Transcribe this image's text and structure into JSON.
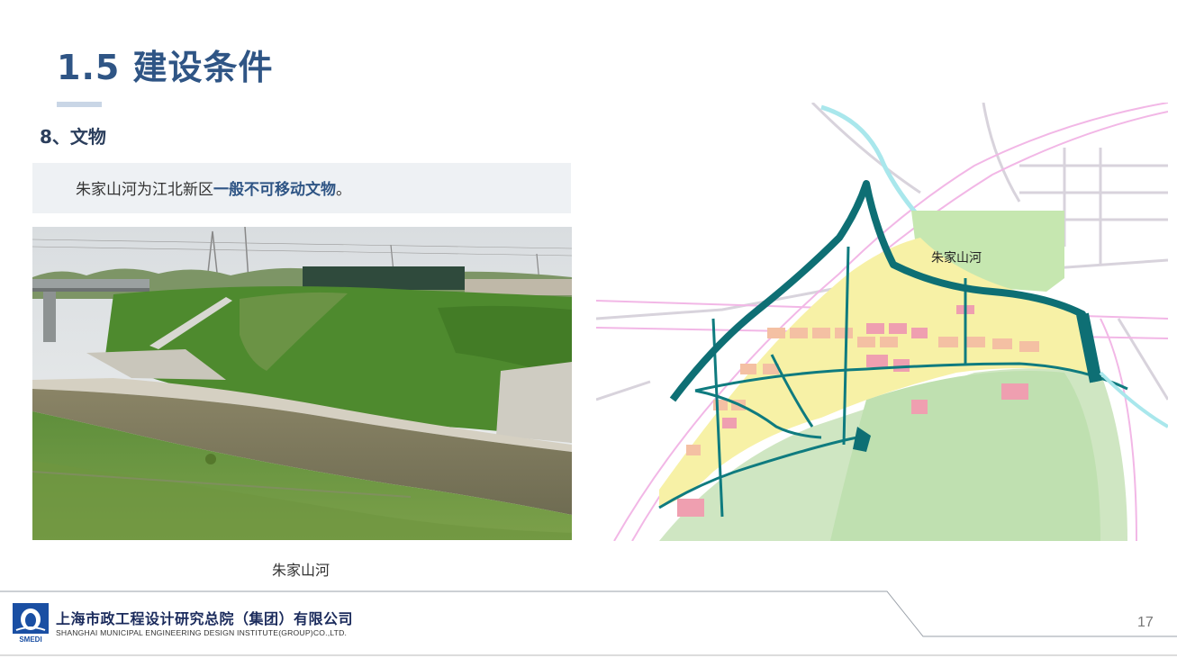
{
  "slide": {
    "title": "1.5 建设条件",
    "subheading": "8、文物",
    "description_prefix": "朱家山河为江北新区",
    "description_highlight": "一般不可移动文物",
    "description_suffix": "。",
    "photo_caption": "朱家山河",
    "map_label": "朱家山河",
    "page_number": "17"
  },
  "footer": {
    "company_cn": "上海市政工程设计研究总院（集团）有限公司",
    "company_en": "SHANGHAI MUNICIPAL ENGINEERING DESIGN INSTITUTE(GROUP)CO.,LTD.",
    "logo_text": "SMEDI"
  },
  "colors": {
    "title": "#2f5585",
    "accent_underline": "#c9d6e6",
    "river": "#0e6f74",
    "desc_box_bg": "#eef1f4"
  }
}
